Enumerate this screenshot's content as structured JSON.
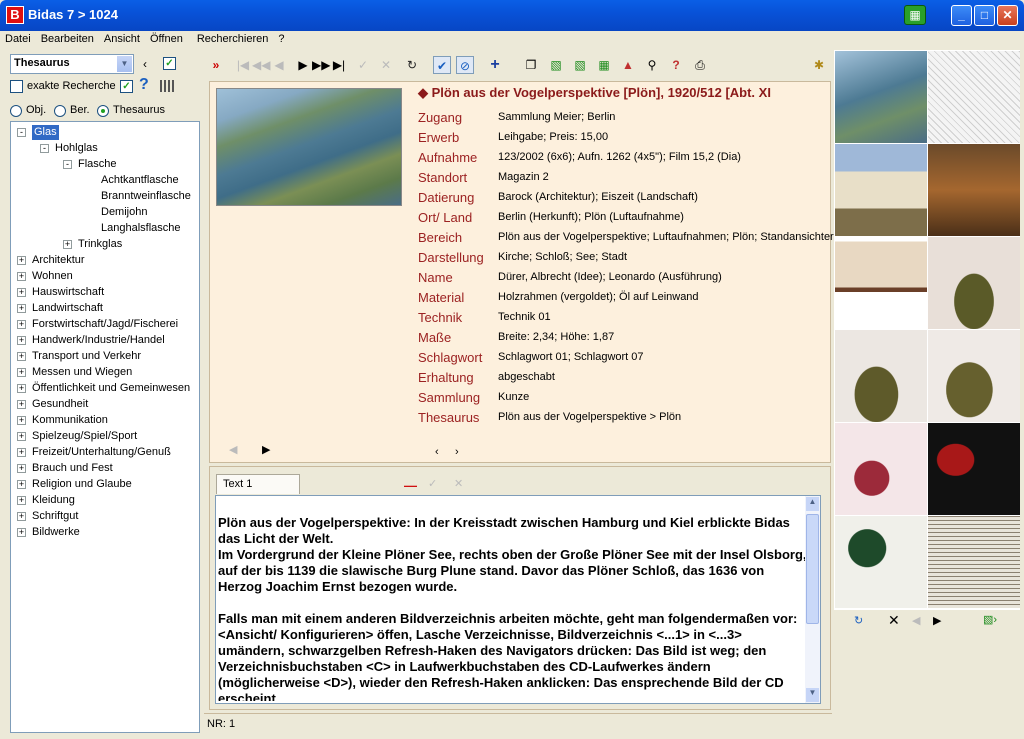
{
  "window": {
    "title": "Bidas 7 > 1024",
    "logo": "B"
  },
  "menu": [
    "Datei",
    "Bearbeiten",
    "Ansicht",
    "Öffnen",
    "Recherchieren",
    "?"
  ],
  "search": {
    "selected": "Thesaurus",
    "exact_label": "exakte Recherche",
    "help": "?"
  },
  "modes": {
    "obj": "Obj.",
    "ber": "Ber.",
    "thes": "Thesaurus"
  },
  "tree": [
    {
      "label": "Glas",
      "level": 0,
      "exp": "-",
      "sel": true
    },
    {
      "label": "Hohlglas",
      "level": 1,
      "exp": "-"
    },
    {
      "label": "Flasche",
      "level": 2,
      "exp": "-"
    },
    {
      "label": "Achtkantflasche",
      "level": 3,
      "exp": ""
    },
    {
      "label": "Branntweinflasche",
      "level": 3,
      "exp": ""
    },
    {
      "label": "Demijohn",
      "level": 3,
      "exp": ""
    },
    {
      "label": "Langhalsflasche",
      "level": 3,
      "exp": ""
    },
    {
      "label": "Trinkglas",
      "level": 2,
      "exp": "+"
    },
    {
      "label": "Architektur",
      "level": 0,
      "exp": "+"
    },
    {
      "label": "Wohnen",
      "level": 0,
      "exp": "+"
    },
    {
      "label": "Hauswirtschaft",
      "level": 0,
      "exp": "+"
    },
    {
      "label": "Landwirtschaft",
      "level": 0,
      "exp": "+"
    },
    {
      "label": "Forstwirtschaft/Jagd/Fischerei",
      "level": 0,
      "exp": "+"
    },
    {
      "label": "Handwerk/Industrie/Handel",
      "level": 0,
      "exp": "+"
    },
    {
      "label": "Transport und Verkehr",
      "level": 0,
      "exp": "+"
    },
    {
      "label": "Messen und Wiegen",
      "level": 0,
      "exp": "+"
    },
    {
      "label": "Öffentlichkeit und Gemeinwesen",
      "level": 0,
      "exp": "+"
    },
    {
      "label": "Gesundheit",
      "level": 0,
      "exp": "+"
    },
    {
      "label": "Kommunikation",
      "level": 0,
      "exp": "+"
    },
    {
      "label": "Spielzeug/Spiel/Sport",
      "level": 0,
      "exp": "+"
    },
    {
      "label": "Freizeit/Unterhaltung/Genuß",
      "level": 0,
      "exp": "+"
    },
    {
      "label": "Brauch und Fest",
      "level": 0,
      "exp": "+"
    },
    {
      "label": "Religion und Glaube",
      "level": 0,
      "exp": "+"
    },
    {
      "label": "Kleidung",
      "level": 0,
      "exp": "+"
    },
    {
      "label": "Schriftgut",
      "level": 0,
      "exp": "+"
    },
    {
      "label": "Bildwerke",
      "level": 0,
      "exp": "+"
    }
  ],
  "record": {
    "title": "Plön aus der Vogelperspektive [Plön], 1920/512  [Abt. XI",
    "fields": [
      [
        "Zugang",
        "Sammlung Meier; Berlin"
      ],
      [
        "Erwerb",
        "Leihgabe; Preis: 15,00"
      ],
      [
        "Aufnahme",
        "123/2002 (6x6); Aufn. 1262 (4x5\"); Film 15,2 (Dia)"
      ],
      [
        "Standort",
        "Magazin 2"
      ],
      [
        "Datierung",
        "Barock (Architektur); Eiszeit (Landschaft)"
      ],
      [
        "Ort/ Land",
        "Berlin (Herkunft); Plön (Luftaufnahme)"
      ],
      [
        "Bereich",
        "Plön aus der Vogelperspektive; Luftaufnahmen; Plön; Standansichter"
      ],
      [
        "Darstellung",
        "Kirche; Schloß; See; Stadt"
      ],
      [
        "Name",
        "Dürer, Albrecht (Idee); Leonardo (Ausführung)"
      ],
      [
        "Material",
        "Holzrahmen (vergoldet); Öl auf Leinwand"
      ],
      [
        "Technik",
        "Technik 01"
      ],
      [
        "Maße",
        "Breite: 2,34; Höhe: 1,87"
      ],
      [
        "Schlagwort",
        "Schlagwort 01; Schlagwort 07"
      ],
      [
        "Erhaltung",
        "abgeschabt"
      ],
      [
        "Sammlung",
        "Kunze"
      ],
      [
        "Thesaurus",
        "Plön aus der Vogelperspektive > Plön"
      ]
    ]
  },
  "text": {
    "tab": "Text 1",
    "content": "Plön aus der Vogelperspektive: In der Kreisstadt zwischen Hamburg und Kiel erblickte Bidas das Licht der Welt.\nIm Vordergrund der Kleine Plöner See, rechts oben der Große Plöner See mit der Insel Olsborg, auf der bis 1139 die slawische Burg Plune stand. Davor das Plöner Schloß, das 1636 von Herzog Joachim Ernst bezogen wurde.\n\nFalls man mit einem anderen Bildverzeichnis arbeiten möchte, geht man folgendermaßen vor: <Ansicht/ Konfigurieren> öffen, Lasche Verzeichnisse, Bildverzeichnis <...1> in <...3> umändern, schwarzgelben Refresh-Haken des Navigators drücken: Das Bild ist weg; den Verzeichnisbuchstaben <C> in Laufwerkbuchstaben des CD-Laufwerkes ändern (möglicherweise <D>), wieder den Refresh-Haken anklicken: Das ensprechende Bild der CD erscheint."
  },
  "status": "NR: 1",
  "colors": {
    "label": "#9c2222",
    "title": "#8b1a1a",
    "record_bg": "#fdf0dd"
  }
}
